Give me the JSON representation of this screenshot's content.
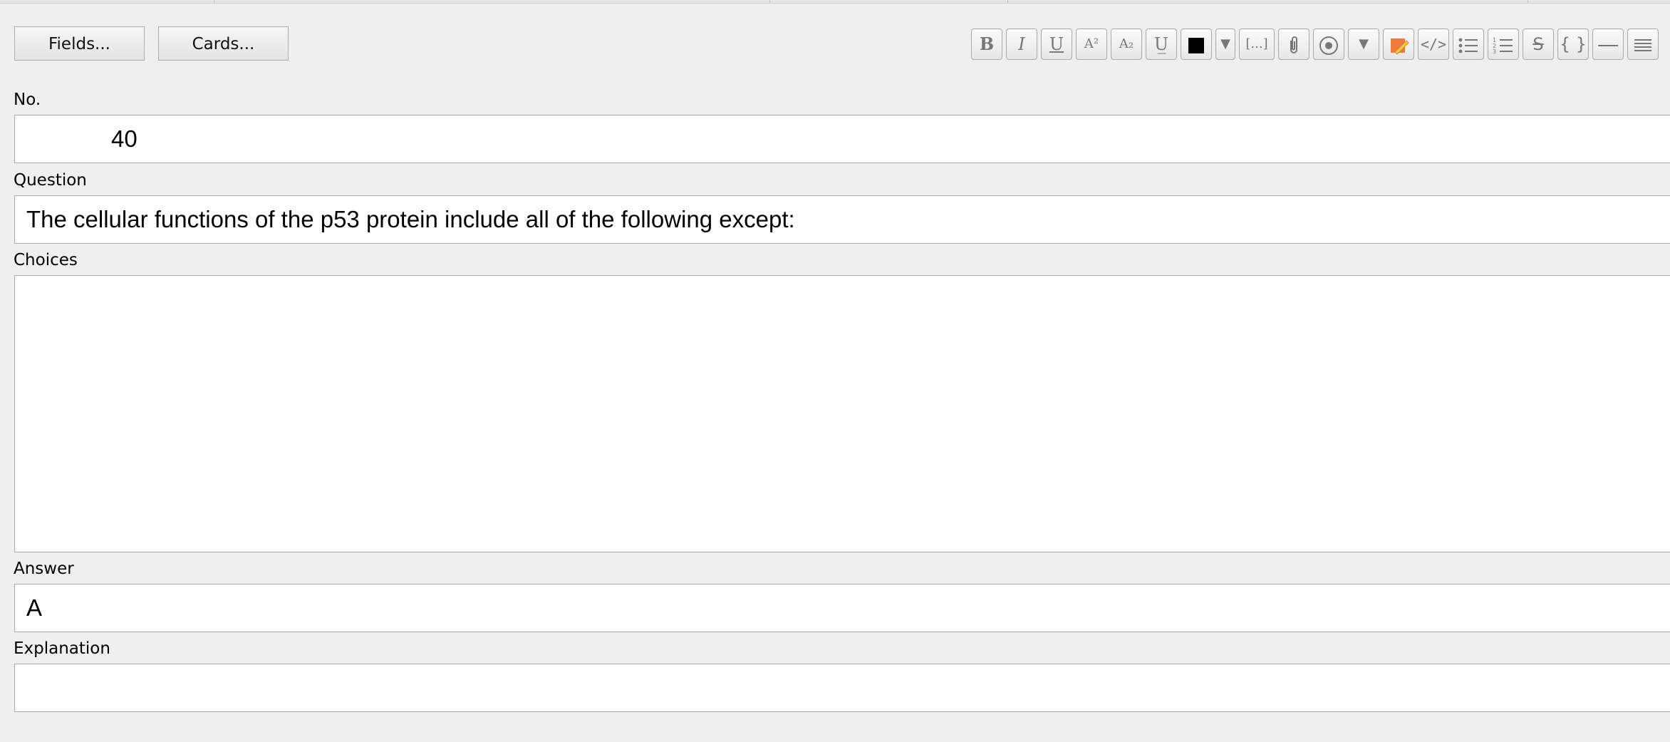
{
  "buttons": {
    "fields": "Fields...",
    "cards": "Cards..."
  },
  "toolbar": {
    "bold": "B",
    "italic": "I",
    "underline": "U",
    "superscript": "A²",
    "subscript": "A₂",
    "clear_format": "U̲",
    "cloze": "[...]",
    "html": "</>",
    "mathjax": "{ }",
    "text_color": "#000000",
    "highlight_color": "#f07a3a"
  },
  "fields": [
    {
      "label": "No.",
      "value": "40"
    },
    {
      "label": "Question",
      "value": "The cellular functions of the p53 protein include all of the following except:"
    },
    {
      "label": "Choices",
      "value": ""
    },
    {
      "label": "Answer",
      "value": "A"
    },
    {
      "label": "Explanation",
      "value": ""
    }
  ]
}
